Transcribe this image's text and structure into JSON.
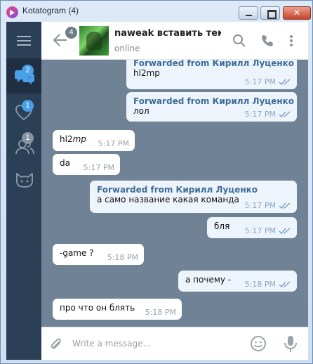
{
  "window": {
    "title": "Kotatogram (4)",
    "close_glyph": "✕"
  },
  "sidebar": {
    "items": [
      {
        "name": "chats",
        "icon": "chats-icon",
        "badge": "2",
        "active": true
      },
      {
        "name": "favorites",
        "icon": "heart-icon",
        "badge": "1"
      },
      {
        "name": "contacts",
        "icon": "people-icon",
        "badge": "1"
      },
      {
        "name": "bots",
        "icon": "cat-icon"
      }
    ]
  },
  "header": {
    "unread_badge": "4",
    "chat_name": "naweak вставить тек...",
    "status": "online"
  },
  "messages": [
    {
      "dir": "out",
      "forwarded": "Forwarded from Кирилл Луценко",
      "text": "hl2mp",
      "time": "5:17 PM"
    },
    {
      "dir": "out",
      "forwarded": "Forwarded from Кирилл Луценко",
      "text": "лол",
      "time": "5:17 PM"
    },
    {
      "dir": "in",
      "text_plain": "hl2",
      "text_italic": "mp",
      "time": "5:17 PM"
    },
    {
      "dir": "in",
      "text": "da",
      "time": "5:17 PM"
    },
    {
      "dir": "out",
      "forwarded": "Forwarded from Кирилл Луценко",
      "text": "а само название какая команда",
      "time": "5:17 PM"
    },
    {
      "dir": "out",
      "text": "бля",
      "time": "5:17 PM"
    },
    {
      "dir": "in",
      "text": "-game ?",
      "time": "5:18 PM"
    },
    {
      "dir": "out",
      "text": "а почему -",
      "time": "5:18 PM"
    },
    {
      "dir": "in",
      "text": "про что он блять",
      "time": "5:18 PM"
    }
  ],
  "composer": {
    "placeholder": "Write a message..."
  },
  "colors": {
    "sidebar": "#2b3f56",
    "chat_background": "#6f8296",
    "accent": "#4aa0e6",
    "forwarded_name": "#3e6d9a",
    "read_ticks": "#6f9bc7"
  }
}
